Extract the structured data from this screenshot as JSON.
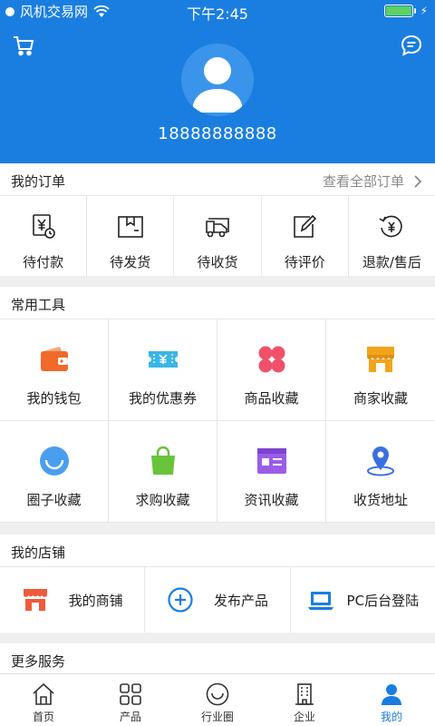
{
  "status_bar": {
    "carrier": "风机交易网",
    "time": "下午2:45"
  },
  "profile": {
    "phone": "18888888888"
  },
  "orders": {
    "title": "我的订单",
    "view_all": "查看全部订单",
    "items": [
      {
        "label": "待付款",
        "icon": "pending-payment-icon"
      },
      {
        "label": "待发货",
        "icon": "pending-shipment-icon"
      },
      {
        "label": "待收货",
        "icon": "pending-receipt-icon"
      },
      {
        "label": "待评价",
        "icon": "pending-review-icon"
      },
      {
        "label": "退款/售后",
        "icon": "refund-icon"
      }
    ]
  },
  "tools": {
    "title": "常用工具",
    "items": [
      {
        "label": "我的钱包",
        "icon": "wallet-icon",
        "color": "#f06a2a"
      },
      {
        "label": "我的优惠券",
        "icon": "coupon-icon",
        "color": "#38b6e8"
      },
      {
        "label": "商品收藏",
        "icon": "flower-icon",
        "color": "#f0506a"
      },
      {
        "label": "商家收藏",
        "icon": "store-icon",
        "color": "#f2a51c"
      },
      {
        "label": "圈子收藏",
        "icon": "smile-icon",
        "color": "#4a9ef0"
      },
      {
        "label": "求购收藏",
        "icon": "bag-icon",
        "color": "#69c33b"
      },
      {
        "label": "资讯收藏",
        "icon": "news-icon",
        "color": "#9a5de8"
      },
      {
        "label": "收货地址",
        "icon": "location-icon",
        "color": "#3a6fe0"
      }
    ]
  },
  "shop": {
    "title": "我的店铺",
    "items": [
      {
        "label": "我的商铺",
        "icon": "shop-icon"
      },
      {
        "label": "发布产品",
        "icon": "plus-circle-icon"
      },
      {
        "label": "PC后台登陆",
        "icon": "laptop-icon"
      }
    ]
  },
  "more": {
    "title": "更多服务"
  },
  "tabbar": {
    "items": [
      {
        "label": "首页",
        "icon": "home-icon"
      },
      {
        "label": "产品",
        "icon": "grid-icon"
      },
      {
        "label": "行业圈",
        "icon": "circle-smile-icon"
      },
      {
        "label": "企业",
        "icon": "building-icon"
      },
      {
        "label": "我的",
        "icon": "user-icon",
        "active": true
      }
    ]
  }
}
